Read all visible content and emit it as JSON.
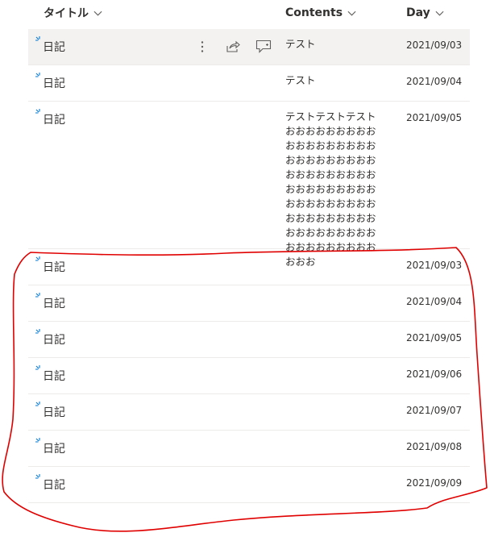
{
  "columns": {
    "title": "タイトル",
    "contents": "Contents",
    "day": "Day"
  },
  "rows": [
    {
      "title": "日記",
      "contents": "テスト",
      "day": "2021/09/03"
    },
    {
      "title": "日記",
      "contents": "テスト",
      "day": "2021/09/04"
    },
    {
      "title": "日記",
      "contents": "テストテストテストおおおおおおおおおおおおおおおおおおおおおおおおおおおおおおおおおおおおおおおおおおおおおおおおおおおおおおおおおおおおおおおおおおおおおおおおおおおおおおおおおおおお",
      "day": "2021/09/05"
    },
    {
      "title": "日記",
      "contents": "",
      "day": "2021/09/03"
    },
    {
      "title": "日記",
      "contents": "",
      "day": "2021/09/04"
    },
    {
      "title": "日記",
      "contents": "",
      "day": "2021/09/05"
    },
    {
      "title": "日記",
      "contents": "",
      "day": "2021/09/06"
    },
    {
      "title": "日記",
      "contents": "",
      "day": "2021/09/07"
    },
    {
      "title": "日記",
      "contents": "",
      "day": "2021/09/08"
    },
    {
      "title": "日記",
      "contents": "",
      "day": "2021/09/09"
    }
  ],
  "colors": {
    "text": "#323130",
    "new_indicator": "#0078d4",
    "annotation": "#e00000",
    "hover_row": "#f3f2f1",
    "divider": "#edebe9"
  },
  "icons": [
    "chevron-down-icon",
    "new-item-icon",
    "more-options-icon",
    "share-icon",
    "comment-icon"
  ]
}
